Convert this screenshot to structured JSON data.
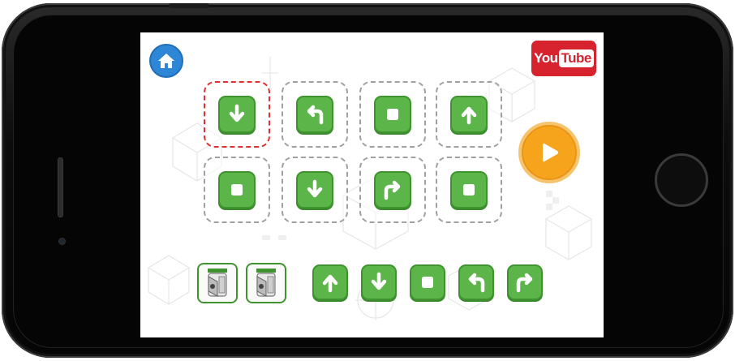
{
  "device": {
    "frame_color": "#0c0c0c"
  },
  "app": {
    "youtube": {
      "you": "You",
      "tube": "Tube",
      "color": "#d6232d"
    },
    "home_icon": "house-icon",
    "play_icon": "play-icon",
    "accent_green": "#5bb548",
    "accent_orange": "#f7a41d",
    "selected_slot_color": "#e03030",
    "program_grid": [
      [
        "arrow-down",
        "turn-left",
        "stop",
        "arrow-up"
      ],
      [
        "stop",
        "arrow-down",
        "turn-right",
        "stop"
      ]
    ],
    "selected_slot": {
      "row": 0,
      "col": 0
    },
    "robot_cards": [
      "robot-icon",
      "robot-icon"
    ],
    "palette": [
      "arrow-up",
      "arrow-down",
      "stop",
      "turn-left",
      "turn-right"
    ]
  }
}
